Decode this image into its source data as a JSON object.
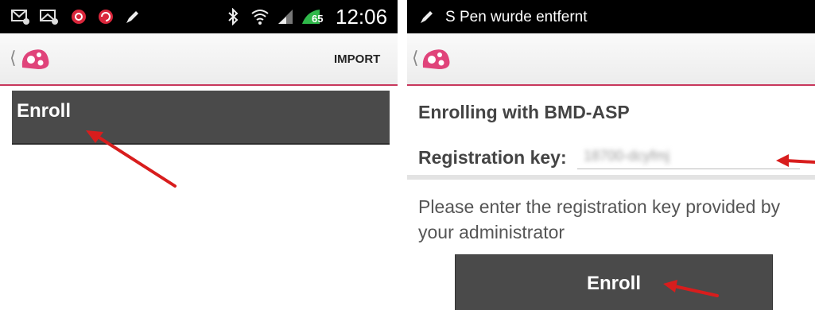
{
  "left_screen": {
    "status_bar": {
      "time": "12:06",
      "battery": "65",
      "icons": [
        "email-icon",
        "email-alert-icon",
        "app-red-icon",
        "sync-icon",
        "pen-icon",
        "bluetooth-icon",
        "wifi-icon",
        "signal-icon",
        "battery-icon"
      ]
    },
    "action_bar": {
      "import_label": "IMPORT"
    },
    "enroll_header": "Enroll"
  },
  "right_screen": {
    "status_bar": {
      "notification": "S Pen wurde entfernt"
    },
    "title": "Enrolling with BMD-ASP",
    "registration_label": "Registration key:",
    "registration_value": "18700-dcyfmj",
    "instructions": "Please enter the registration key provided by your administrator",
    "enroll_button": "Enroll"
  },
  "colors": {
    "accent": "#c8375c",
    "dark_panel": "#4a4a4a",
    "logo": "#e0437a",
    "annotation_arrow": "#d81d1d"
  }
}
